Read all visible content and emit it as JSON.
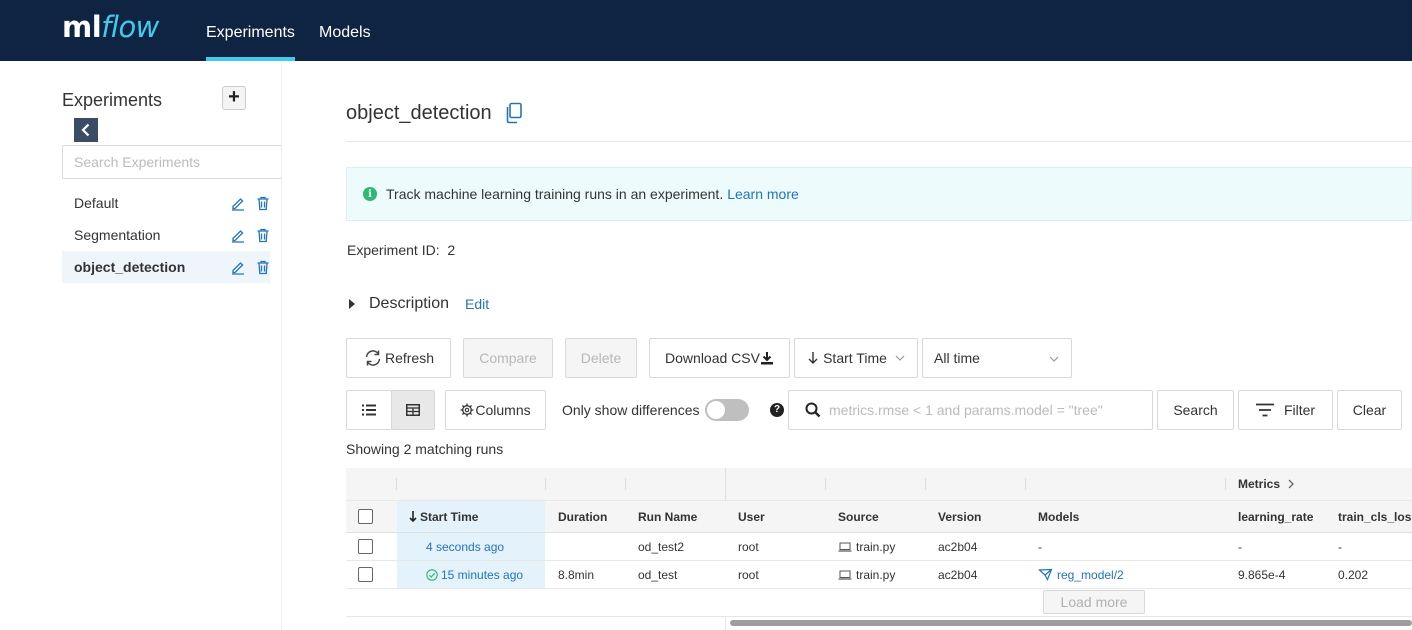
{
  "header": {
    "logo_ml": "ml",
    "logo_flow": "flow",
    "nav": [
      {
        "label": "Experiments",
        "active": true
      },
      {
        "label": "Models",
        "active": false
      }
    ]
  },
  "sidebar": {
    "title": "Experiments",
    "add_label": "+",
    "search_placeholder": "Search Experiments",
    "items": [
      {
        "name": "Default",
        "active": false
      },
      {
        "name": "Segmentation",
        "active": false
      },
      {
        "name": "object_detection",
        "active": true
      }
    ]
  },
  "main": {
    "title": "object_detection",
    "alert_text": "Track machine learning training runs in an experiment.",
    "alert_link": "Learn more",
    "experiment_id_label": "Experiment ID",
    "experiment_id_sep": ":",
    "experiment_id_value": "2",
    "description_label": "Description",
    "description_edit": "Edit",
    "toolbar": {
      "refresh": "Refresh",
      "compare": "Compare",
      "delete": "Delete",
      "download_csv": "Download CSV",
      "sort_by": "Start Time",
      "time_range": "All time",
      "columns": "Columns",
      "only_diff": "Only show differences",
      "search_placeholder": "metrics.rmse < 1 and params.model = \"tree\"",
      "search": "Search",
      "filter": "Filter",
      "clear": "Clear"
    },
    "showing": "Showing 2 matching runs",
    "table": {
      "group_metrics": "Metrics",
      "columns": [
        "Start Time",
        "Duration",
        "Run Name",
        "User",
        "Source",
        "Version",
        "Models",
        "learning_rate",
        "train_cls_loss"
      ],
      "rows": [
        {
          "start_time": "4 seconds ago",
          "status": "running",
          "duration": "",
          "run_name": "od_test2",
          "user": "root",
          "source": "train.py",
          "version": "ac2b04",
          "models": "-",
          "learning_rate": "-",
          "train_cls_loss": "-"
        },
        {
          "start_time": "15 minutes ago",
          "status": "finished",
          "duration": "8.8min",
          "run_name": "od_test",
          "user": "root",
          "source": "train.py",
          "version": "ac2b04",
          "models": "reg_model/2",
          "learning_rate": "9.865e-4",
          "train_cls_loss": "0.202"
        }
      ],
      "load_more": "Load more"
    }
  },
  "colors": {
    "header_bg": "#0e2442",
    "accent": "#43c9ed",
    "link": "#2374bb",
    "success": "#2eb872"
  }
}
